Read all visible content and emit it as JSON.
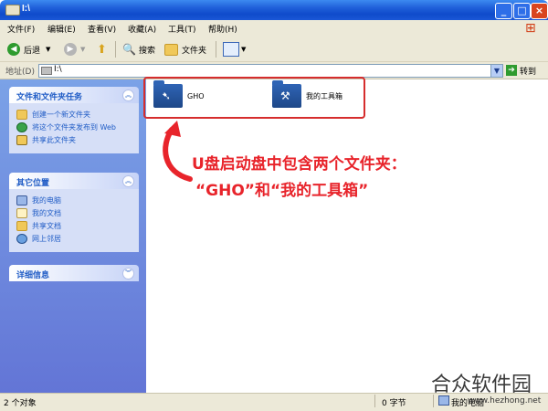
{
  "window": {
    "title": "I:\\"
  },
  "menu": [
    "文件(F)",
    "编辑(E)",
    "查看(V)",
    "收藏(A)",
    "工具(T)",
    "帮助(H)"
  ],
  "toolbar": {
    "back": "后退",
    "search": "搜索",
    "folders": "文件夹"
  },
  "address": {
    "label": "地址(D)",
    "value": "I:\\",
    "go": "转到"
  },
  "panels": [
    {
      "title": "文件和文件夹任务",
      "items": [
        {
          "icon": "new-folder-icon",
          "label": "创建一个新文件夹"
        },
        {
          "icon": "globe-icon",
          "label": "将这个文件夹发布到 Web"
        },
        {
          "icon": "share-folder-icon",
          "label": "共享此文件夹"
        }
      ]
    },
    {
      "title": "其它位置",
      "items": [
        {
          "icon": "my-computer-icon",
          "label": "我的电脑"
        },
        {
          "icon": "my-documents-icon",
          "label": "我的文档"
        },
        {
          "icon": "shared-docs-icon",
          "label": "共享文档"
        },
        {
          "icon": "network-icon",
          "label": "网上邻居"
        }
      ]
    },
    {
      "title": "详细信息",
      "items": []
    }
  ],
  "folders": [
    {
      "name": "GHO",
      "icon": "gho-folder-icon"
    },
    {
      "name": "我的工具箱",
      "icon": "toolbox-folder-icon"
    }
  ],
  "annotation": {
    "line1": "U盘启动盘中包含两个文件夹：",
    "line2": "“GHO”和“我的工具箱”",
    "color": "#e8242b"
  },
  "status": {
    "objects": "2 个对象",
    "size": "0 字节",
    "location": "我的电脑"
  },
  "watermark": {
    "name": "合众软件园",
    "url": "www.hezhong.net"
  }
}
